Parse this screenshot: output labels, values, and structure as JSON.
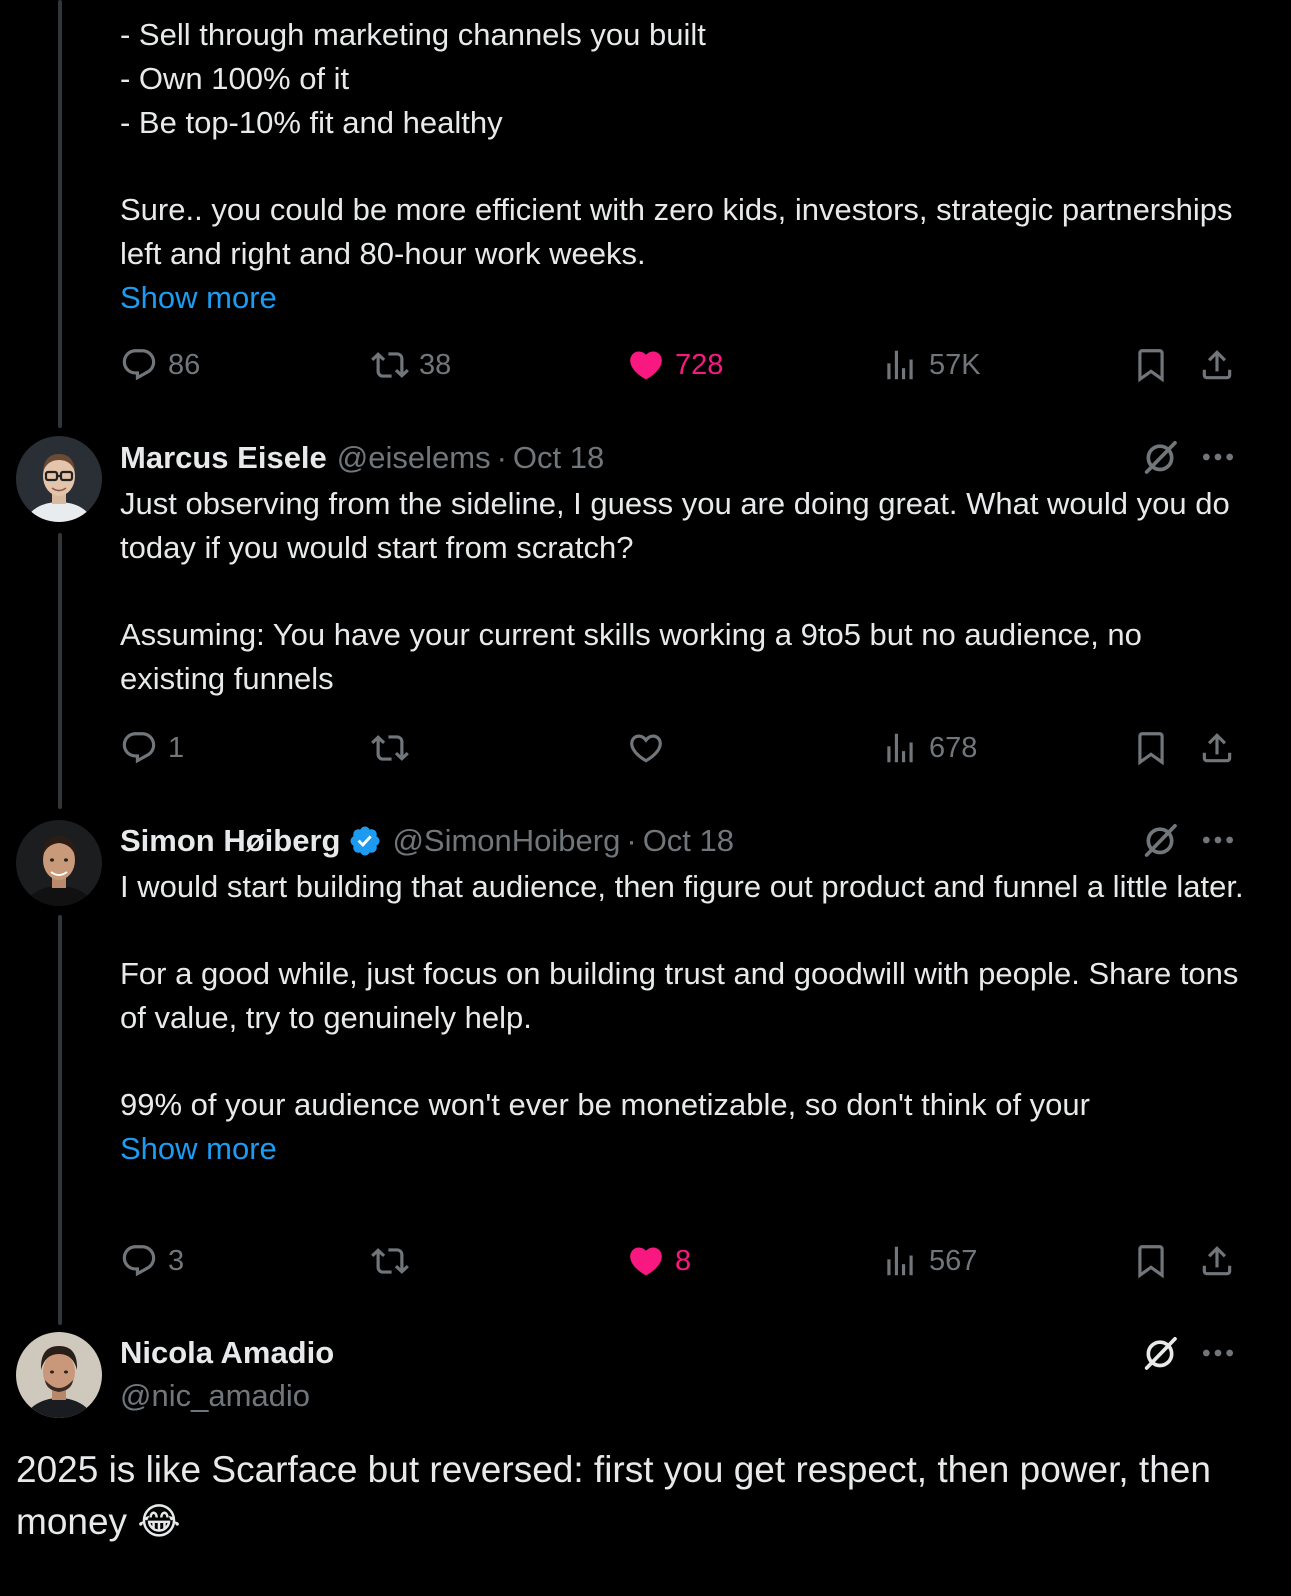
{
  "tweet0": {
    "lines": [
      "- Sell through marketing channels you built",
      "- Own 100% of it",
      "- Be top-10% fit and healthy"
    ],
    "paragraph": "Sure.. you could be more efficient with zero kids, investors, strategic partnerships left and right and 80-hour work weeks.",
    "show_more": "Show more",
    "replies": "86",
    "reposts": "38",
    "likes": "728",
    "views": "57K"
  },
  "tweet1": {
    "name": "Marcus Eisele",
    "handle": "@eiselems",
    "dot": "·",
    "date": "Oct 18",
    "p1": "Just observing from the sideline, I guess you are doing great. What would you do today if you would start from scratch?",
    "p2": "Assuming: You have your current skills working a 9to5 but no audience, no existing funnels",
    "replies": "1",
    "views": "678"
  },
  "tweet2": {
    "name": "Simon Høiberg",
    "handle": "@SimonHoiberg",
    "dot": "·",
    "date": "Oct 18",
    "p1": "I would start building that audience, then figure out product and funnel a little later.",
    "p2": "For a good while, just focus on building trust and goodwill with people. Share tons of value, try to genuinely help.",
    "p3": "99% of your audience won't ever be monetizable, so don't think of your",
    "show_more": "Show more",
    "replies": "3",
    "likes": "8",
    "views": "567"
  },
  "main_tweet": {
    "name": "Nicola Amadio",
    "handle": "@nic_amadio",
    "text": "2025 is like Scarface but reversed: first you get respect, then power, then money 😂"
  },
  "colors": {
    "link": "#1d9bf0",
    "like": "#f91880",
    "muted": "#71767b",
    "text": "#e7e9ea",
    "verified": "#1d9bf0"
  }
}
